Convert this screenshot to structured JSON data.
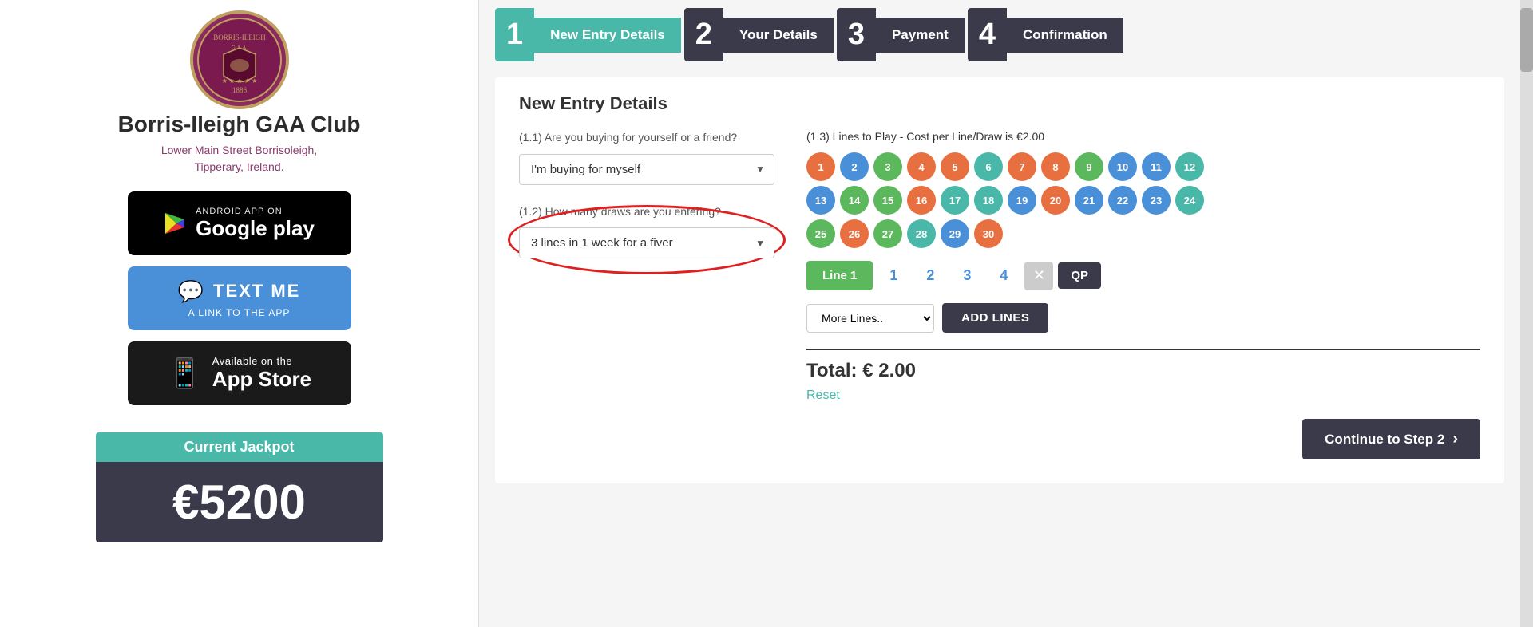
{
  "sidebar": {
    "club_name": "Borris-Ileigh GAA Club",
    "club_address": "Lower Main Street Borrisoleigh,\nTipperary, Ireland.",
    "google_play": {
      "small_text": "ANDROID APP ON",
      "big_text": "Google play"
    },
    "text_me": {
      "top_line": "TEXT ME",
      "bottom_line": "A LINK TO THE APP"
    },
    "app_store": {
      "top_line": "Available on the",
      "bottom_line": "App Store"
    },
    "jackpot": {
      "label": "Current Jackpot",
      "amount": "€5200"
    }
  },
  "steps": [
    {
      "number": "1",
      "label": "New Entry Details",
      "active": true
    },
    {
      "number": "2",
      "label": "Your Details",
      "active": false
    },
    {
      "number": "3",
      "label": "Payment",
      "active": false
    },
    {
      "number": "4",
      "label": "Confirmation",
      "active": false
    }
  ],
  "main": {
    "section_title": "New Entry Details",
    "q1_label": "(1.1) Are you buying for yourself or a friend?",
    "q1_value": "I'm buying for myself",
    "q2_label": "(1.2) How many draws are you entering?",
    "q2_value": "3 lines in 1 week for a fiver",
    "q3_label": "(1.3) Lines to Play - Cost per Line/Draw is €2.00",
    "numbers": [
      {
        "n": "1",
        "color": "ball-orange"
      },
      {
        "n": "2",
        "color": "ball-blue"
      },
      {
        "n": "3",
        "color": "ball-green"
      },
      {
        "n": "4",
        "color": "ball-orange"
      },
      {
        "n": "5",
        "color": "ball-orange"
      },
      {
        "n": "6",
        "color": "ball-teal"
      },
      {
        "n": "7",
        "color": "ball-orange"
      },
      {
        "n": "8",
        "color": "ball-orange"
      },
      {
        "n": "9",
        "color": "ball-green"
      },
      {
        "n": "10",
        "color": "ball-blue"
      },
      {
        "n": "11",
        "color": "ball-blue"
      },
      {
        "n": "12",
        "color": "ball-teal"
      },
      {
        "n": "13",
        "color": "ball-blue"
      },
      {
        "n": "14",
        "color": "ball-green"
      },
      {
        "n": "15",
        "color": "ball-green"
      },
      {
        "n": "16",
        "color": "ball-orange"
      },
      {
        "n": "17",
        "color": "ball-teal"
      },
      {
        "n": "18",
        "color": "ball-teal"
      },
      {
        "n": "19",
        "color": "ball-blue"
      },
      {
        "n": "20",
        "color": "ball-orange"
      },
      {
        "n": "21",
        "color": "ball-blue"
      },
      {
        "n": "22",
        "color": "ball-blue"
      },
      {
        "n": "23",
        "color": "ball-blue"
      },
      {
        "n": "24",
        "color": "ball-teal"
      },
      {
        "n": "25",
        "color": "ball-green"
      },
      {
        "n": "26",
        "color": "ball-orange"
      },
      {
        "n": "27",
        "color": "ball-green"
      },
      {
        "n": "28",
        "color": "ball-teal"
      },
      {
        "n": "29",
        "color": "ball-blue"
      },
      {
        "n": "30",
        "color": "ball-orange"
      }
    ],
    "line_tab": "Line 1",
    "line_numbers": [
      "1",
      "2",
      "3",
      "4"
    ],
    "more_lines_placeholder": "More Lines..",
    "add_lines_label": "ADD LINES",
    "total_label": "Total: € 2.00",
    "reset_label": "Reset",
    "continue_label": "Continue to Step 2"
  }
}
